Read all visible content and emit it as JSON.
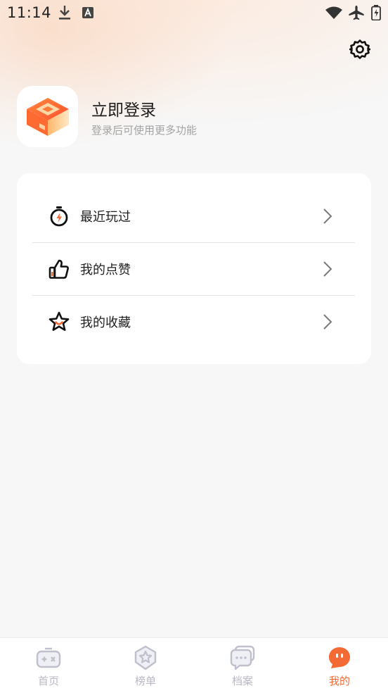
{
  "status_bar": {
    "time": "11:14",
    "icons_left": [
      "download-icon",
      "text-a-icon"
    ],
    "icons_right": [
      "wifi-icon",
      "airplane-mode-icon",
      "battery-icon"
    ]
  },
  "header": {
    "settings_icon": "gear-icon",
    "logo_icon": "app-logo-icon",
    "login_title": "立即登录",
    "login_subtitle": "登录后可使用更多功能"
  },
  "menu": {
    "items": [
      {
        "label": "最近玩过",
        "icon": "stopwatch-icon"
      },
      {
        "label": "我的点赞",
        "icon": "thumbs-up-icon"
      },
      {
        "label": "我的收藏",
        "icon": "star-icon"
      }
    ]
  },
  "tab_bar": {
    "tabs": [
      {
        "label": "首页",
        "icon": "gamepad-icon",
        "active": false
      },
      {
        "label": "榜单",
        "icon": "badge-star-icon",
        "active": false
      },
      {
        "label": "档案",
        "icon": "chat-bubbles-icon",
        "active": false
      },
      {
        "label": "我的",
        "icon": "profile-bubble-icon",
        "active": true
      }
    ]
  },
  "colors": {
    "accent": "#f46a35",
    "inactive_tab": "#b8b8c6",
    "background": "#f7f7f7",
    "subtitle": "#a3a3a3"
  }
}
